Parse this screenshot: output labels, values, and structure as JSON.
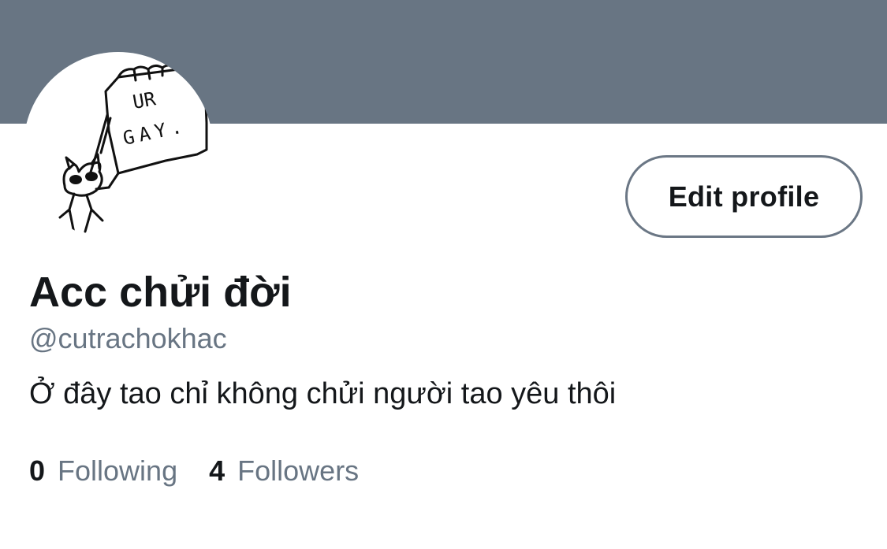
{
  "profile": {
    "display_name": "Acc chửi đời",
    "handle": "@cutrachokhac",
    "bio": "Ở đây tao chỉ không chửi người tao yêu thôi",
    "avatar_drawing_text": "UR GAY."
  },
  "actions": {
    "edit_profile_label": "Edit profile"
  },
  "stats": {
    "following_count": "0",
    "following_label": "Following",
    "followers_count": "4",
    "followers_label": "Followers"
  },
  "colors": {
    "banner": "#687583",
    "text_primary": "#14171a",
    "text_secondary": "#687583",
    "button_border": "#6b7785"
  }
}
